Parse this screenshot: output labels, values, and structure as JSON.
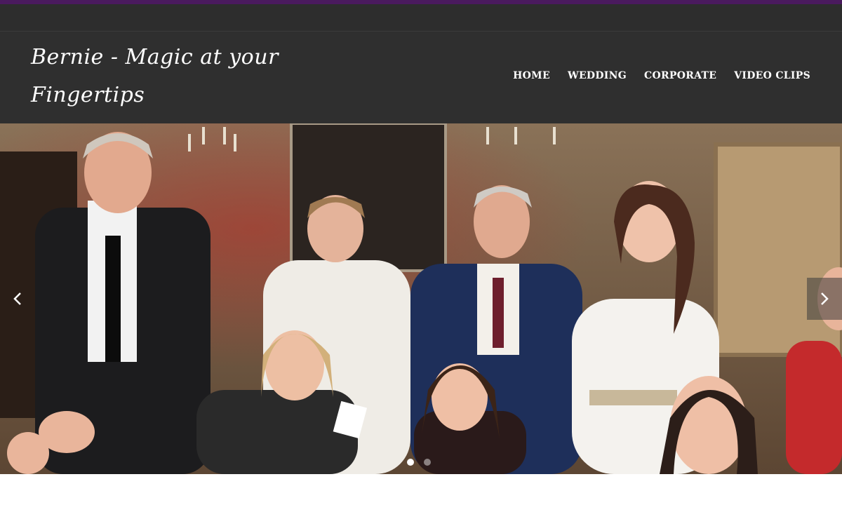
{
  "site": {
    "logo_line1": "Bernie - Magic at your",
    "logo_line2": "Fingertips"
  },
  "nav": {
    "items": [
      {
        "label": "HOME"
      },
      {
        "label": "WEDDING"
      },
      {
        "label": "CORPORATE"
      },
      {
        "label": "VIDEO CLIPS"
      }
    ]
  },
  "slider": {
    "image_icon": "photo",
    "prev_icon": "chevron-left-icon",
    "next_icon": "chevron-right-icon",
    "slide_count": 2,
    "active_slide": 1
  },
  "colors": {
    "accent": "#4a1a5e",
    "header_bg": "#2f2f2f",
    "nav_text": "#ffffff"
  }
}
